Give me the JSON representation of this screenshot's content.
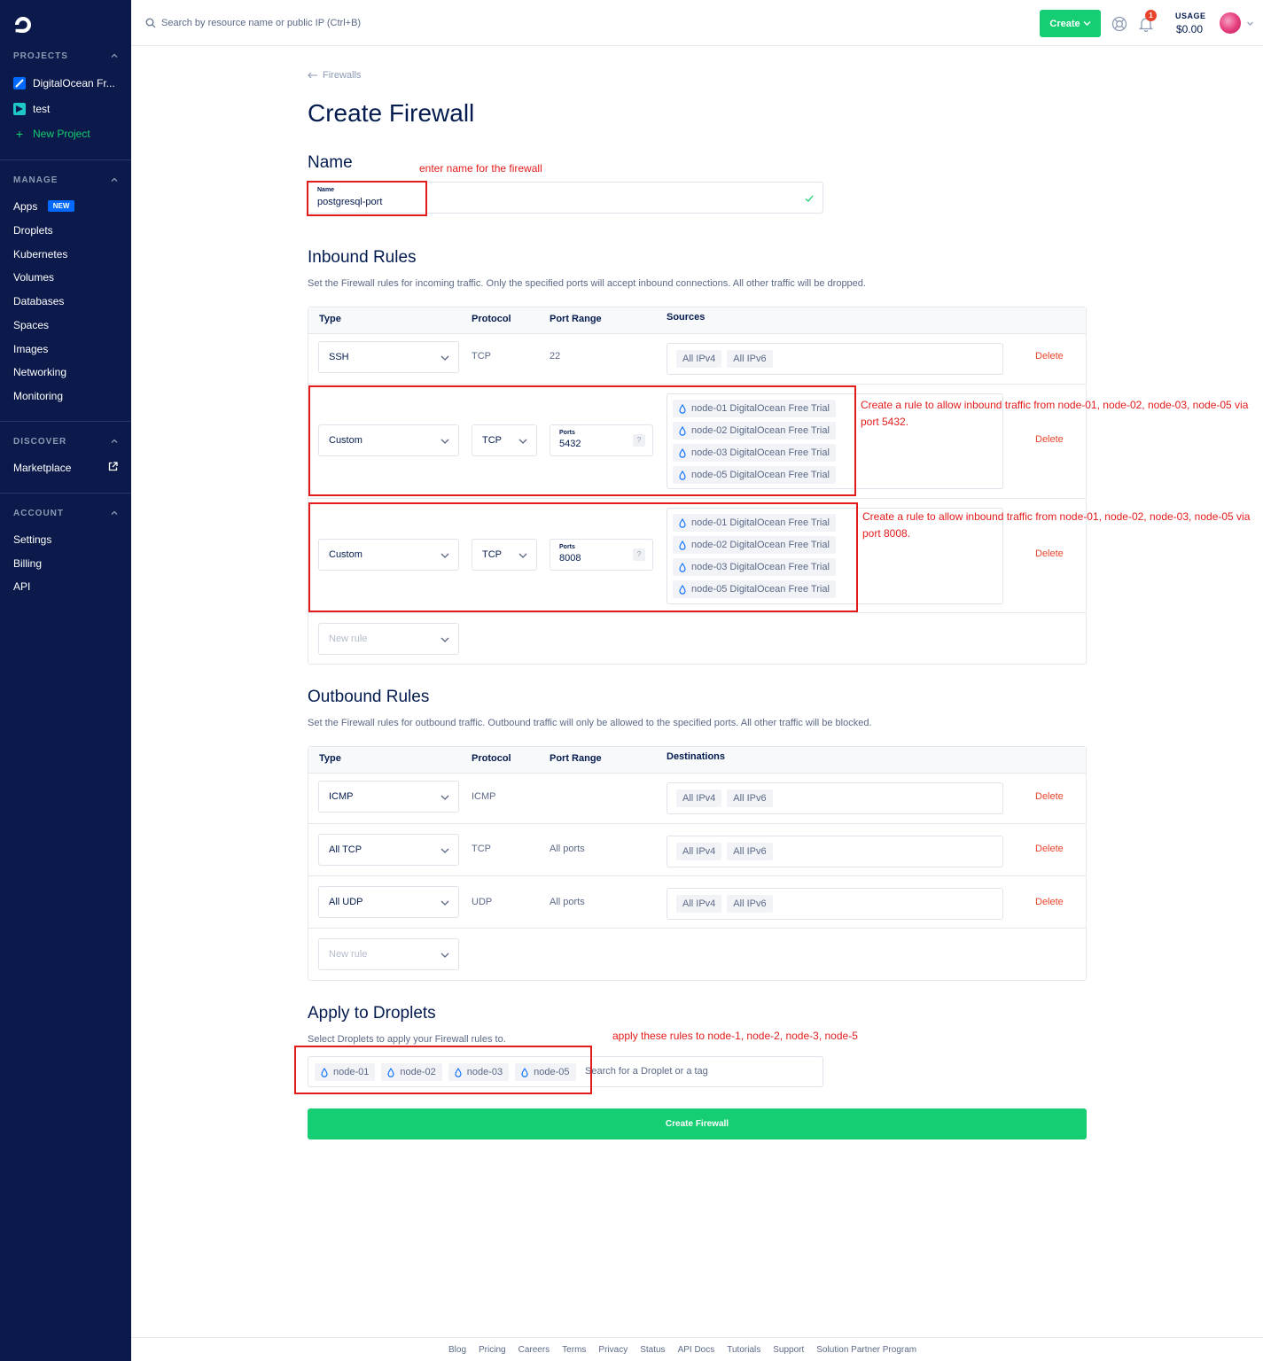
{
  "sidebar": {
    "projects_header": "PROJECTS",
    "projects": [
      {
        "label": "DigitalOcean Fr...",
        "color": "#0069ff"
      },
      {
        "label": "test",
        "color": "#1fc7c7"
      }
    ],
    "new_project": "New Project",
    "manage_header": "MANAGE",
    "manage_items": [
      "Apps",
      "Droplets",
      "Kubernetes",
      "Volumes",
      "Databases",
      "Spaces",
      "Images",
      "Networking",
      "Monitoring"
    ],
    "new_badge": "NEW",
    "discover_header": "DISCOVER",
    "discover_items": [
      "Marketplace"
    ],
    "account_header": "ACCOUNT",
    "account_items": [
      "Settings",
      "Billing",
      "API"
    ]
  },
  "topbar": {
    "search_placeholder": "Search by resource name or public IP (Ctrl+B)",
    "create_label": "Create",
    "notifications_count": "1",
    "usage_label": "USAGE",
    "usage_value": "$0.00"
  },
  "breadcrumb": "Firewalls",
  "page_title": "Create Firewall",
  "name_section": {
    "title": "Name",
    "field_label": "Name",
    "field_value": "postgresql-port",
    "annotation": "enter name for the firewall"
  },
  "inbound": {
    "title": "Inbound Rules",
    "description": "Set the Firewall rules for incoming traffic. Only the specified ports will accept inbound connections. All other traffic will be dropped.",
    "headers": {
      "type": "Type",
      "protocol": "Protocol",
      "port_range": "Port Range",
      "sources": "Sources"
    },
    "ssh_row": {
      "type": "SSH",
      "protocol": "TCP",
      "port": "22",
      "sources": [
        "All IPv4",
        "All IPv6"
      ],
      "delete": "Delete"
    },
    "custom_rows": [
      {
        "type": "Custom",
        "protocol": "TCP",
        "ports_label": "Ports",
        "ports_value": "5432",
        "sources": [
          "node-01 DigitalOcean Free Trial",
          "node-02 DigitalOcean Free Trial",
          "node-03 DigitalOcean Free Trial",
          "node-05 DigitalOcean Free Trial"
        ],
        "delete": "Delete",
        "annotation": "Create a rule to allow inbound traffic from node-01, node-02, node-03, node-05 via port 5432."
      },
      {
        "type": "Custom",
        "protocol": "TCP",
        "ports_label": "Ports",
        "ports_value": "8008",
        "sources": [
          "node-01 DigitalOcean Free Trial",
          "node-02 DigitalOcean Free Trial",
          "node-03 DigitalOcean Free Trial",
          "node-05 DigitalOcean Free Trial"
        ],
        "delete": "Delete",
        "annotation": "Create a rule to allow inbound traffic from node-01, node-02, node-03, node-05 via port 8008."
      }
    ],
    "help_mark": "?",
    "new_rule": "New rule"
  },
  "outbound": {
    "title": "Outbound Rules",
    "description": "Set the Firewall rules for outbound traffic. Outbound traffic will only be allowed to the specified ports. All other traffic will be blocked.",
    "headers": {
      "type": "Type",
      "protocol": "Protocol",
      "port_range": "Port Range",
      "destinations": "Destinations"
    },
    "rows": [
      {
        "type": "ICMP",
        "protocol": "ICMP",
        "port": "",
        "destinations": [
          "All IPv4",
          "All IPv6"
        ],
        "delete": "Delete"
      },
      {
        "type": "All TCP",
        "protocol": "TCP",
        "port": "All ports",
        "destinations": [
          "All IPv4",
          "All IPv6"
        ],
        "delete": "Delete"
      },
      {
        "type": "All UDP",
        "protocol": "UDP",
        "port": "All ports",
        "destinations": [
          "All IPv4",
          "All IPv6"
        ],
        "delete": "Delete"
      }
    ],
    "new_rule": "New rule"
  },
  "apply": {
    "title": "Apply to Droplets",
    "description": "Select Droplets to apply your Firewall rules to.",
    "droplets": [
      "node-01",
      "node-02",
      "node-03",
      "node-05"
    ],
    "search_placeholder": "Search for a Droplet or a tag",
    "annotation": "apply these rules to node-1, node-2, node-3, node-5"
  },
  "create_button": "Create Firewall",
  "footer_links": [
    "Blog",
    "Pricing",
    "Careers",
    "Terms",
    "Privacy",
    "Status",
    "API Docs",
    "Tutorials",
    "Support",
    "Solution Partner Program"
  ],
  "colors": {
    "accent": "#0069ff",
    "primary_button": "#15cd72",
    "danger": "#e8432c",
    "annotation": "#e31b1b",
    "sidebar_bg": "#0b1a4a"
  }
}
